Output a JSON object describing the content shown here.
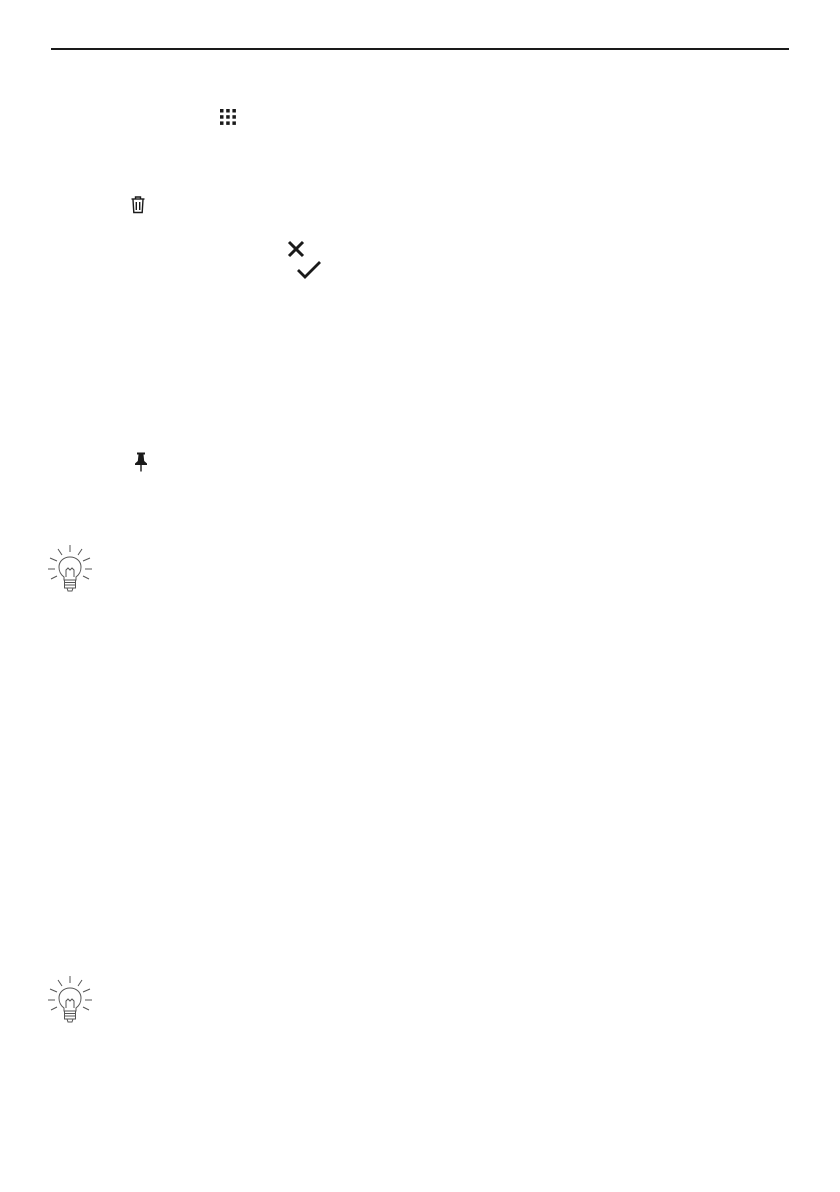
{
  "page": {
    "background": "#ffffff",
    "ink_color": "#1a1a1a",
    "tip_icon_color": "#555555"
  },
  "icons": [
    {
      "name": "apps-grid-icon"
    },
    {
      "name": "trash-icon"
    },
    {
      "name": "close-icon"
    },
    {
      "name": "check-icon"
    },
    {
      "name": "pin-icon"
    },
    {
      "name": "lightbulb-tip-icon"
    },
    {
      "name": "lightbulb-tip-icon"
    }
  ]
}
